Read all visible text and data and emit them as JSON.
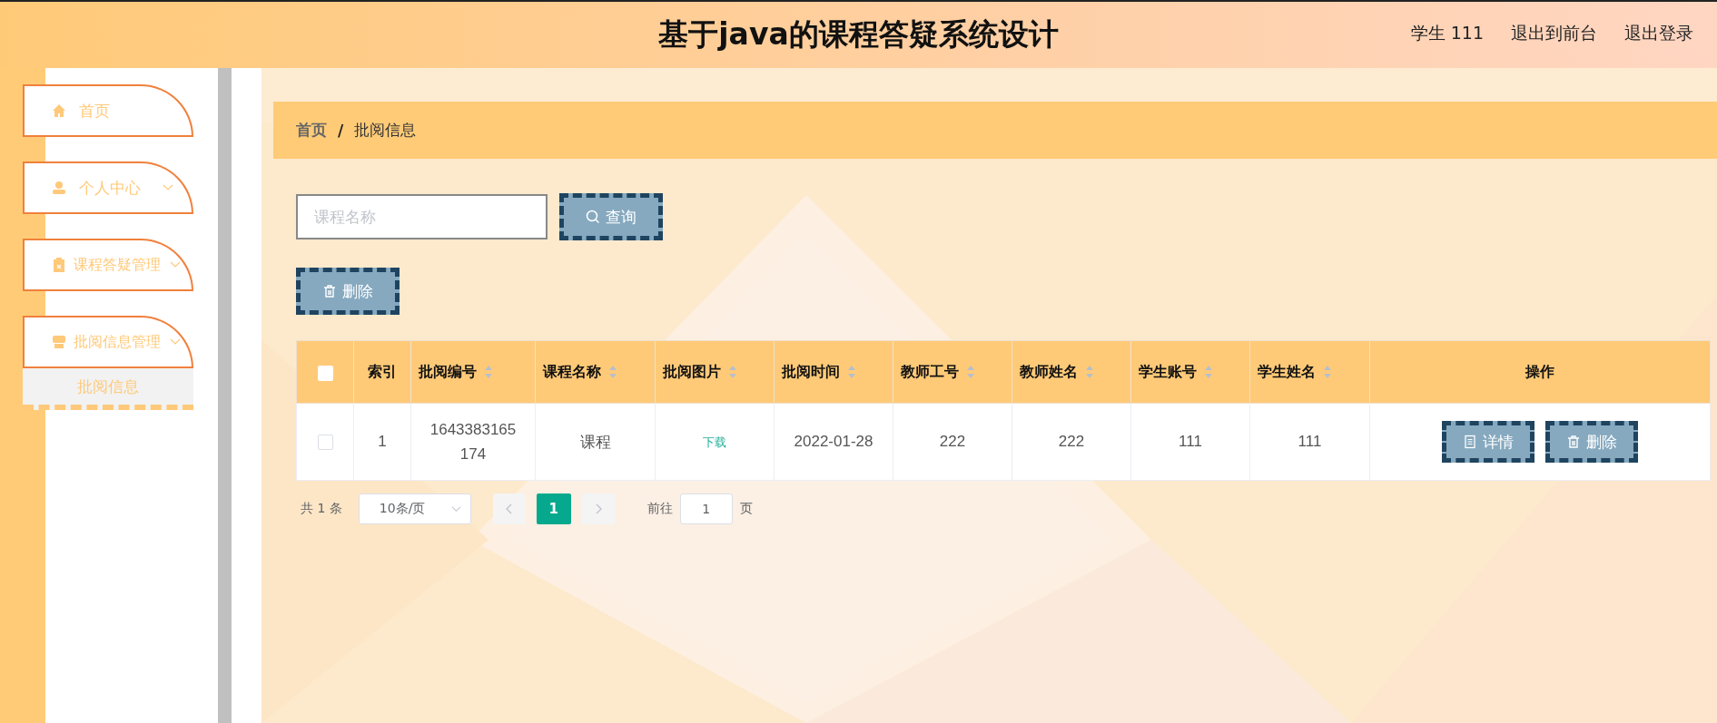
{
  "header": {
    "title": "基于java的课程答疑系统设计",
    "user": "学生 111",
    "links": [
      "退出到前台",
      "退出登录"
    ]
  },
  "sidebar": {
    "items": [
      {
        "label": "首页",
        "kind": "link",
        "expanded": false
      },
      {
        "label": "个人中心",
        "kind": "submenu",
        "expanded": false
      },
      {
        "label": "课程答疑管理",
        "kind": "submenu",
        "expanded": false
      },
      {
        "label": "批阅信息管理",
        "kind": "submenu",
        "expanded": true,
        "children": [
          {
            "label": "批阅信息",
            "selected": true
          }
        ]
      }
    ]
  },
  "breadcrumb": {
    "separator": "/",
    "items": [
      "首页",
      "批阅信息"
    ]
  },
  "search": {
    "placeholder": "课程名称",
    "button": "查询"
  },
  "delete_button": "删除",
  "table": {
    "select_all": {
      "checked": false
    },
    "columns": [
      {
        "label": "索引",
        "sortable": false
      },
      {
        "label": "批阅编号",
        "sortable": true
      },
      {
        "label": "课程名称",
        "sortable": true
      },
      {
        "label": "批阅图片",
        "sortable": true
      },
      {
        "label": "批阅时间",
        "sortable": true
      },
      {
        "label": "教师工号",
        "sortable": true
      },
      {
        "label": "教师姓名",
        "sortable": true
      },
      {
        "label": "学生账号",
        "sortable": true
      },
      {
        "label": "学生姓名",
        "sortable": true
      },
      {
        "label": "操作",
        "sortable": false
      }
    ],
    "rows": [
      {
        "checked": false,
        "cells": [
          {
            "kind": "text",
            "text": "1"
          },
          {
            "kind": "text",
            "text": "1643383165174"
          },
          {
            "kind": "text",
            "text": "课程"
          },
          {
            "kind": "link",
            "text": "下载"
          },
          {
            "kind": "text",
            "text": "2022-01-28"
          },
          {
            "kind": "text",
            "text": "222"
          },
          {
            "kind": "text",
            "text": "222"
          },
          {
            "kind": "text",
            "text": "111"
          },
          {
            "kind": "text",
            "text": "111"
          }
        ],
        "actions": [
          {
            "kind": "detail",
            "label": "详情"
          },
          {
            "kind": "delete",
            "label": "删除"
          }
        ]
      }
    ]
  },
  "pagination": {
    "total": "共 1 条",
    "page_size": "10条/页",
    "prev_disabled": true,
    "next_disabled": true,
    "pages": [
      {
        "label": "1",
        "selected": true
      }
    ],
    "goto_label": "前往",
    "goto_value": "1",
    "goto_suffix": "页"
  }
}
